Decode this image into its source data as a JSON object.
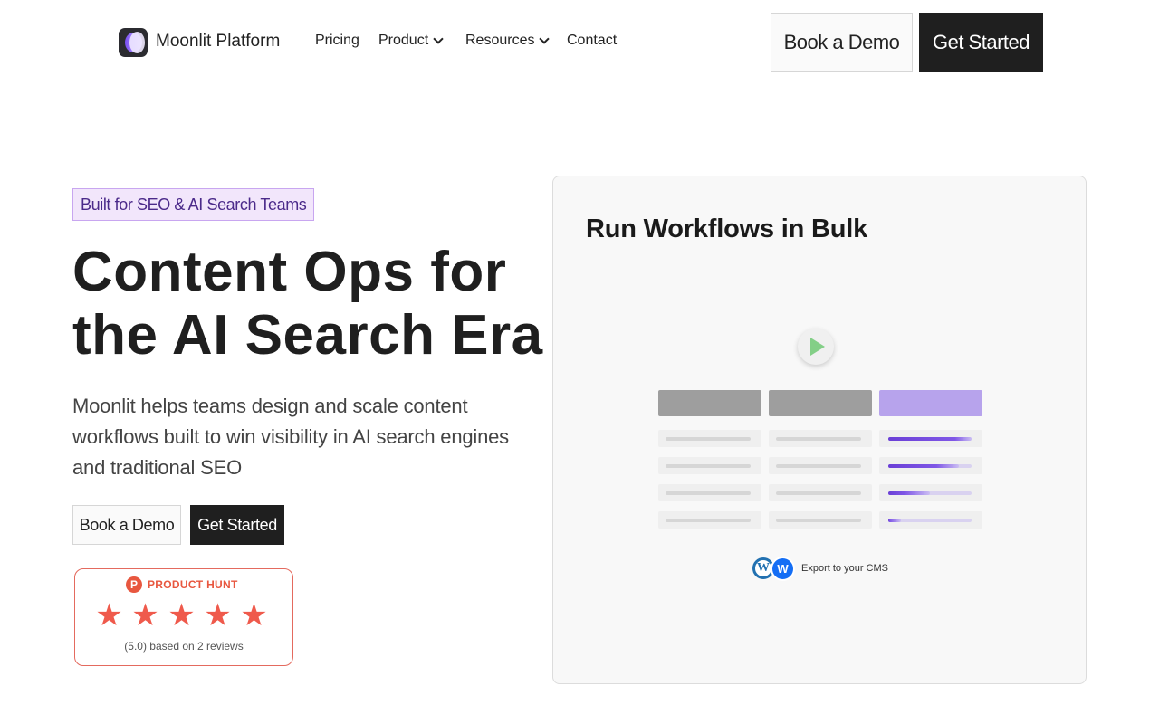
{
  "header": {
    "brand": "Moonlit Platform",
    "nav": [
      {
        "label": "Pricing",
        "dropdown": false
      },
      {
        "label": "Product",
        "dropdown": true
      },
      {
        "label": "Resources",
        "dropdown": true
      },
      {
        "label": "Contact",
        "dropdown": false
      }
    ],
    "book_demo_label": "Book a Demo",
    "get_started_label": "Get Started"
  },
  "hero": {
    "badge": "Built for SEO & AI Search Teams",
    "headline_line1": "Content Ops for",
    "headline_line2": "the AI Search Era",
    "subtext": "Moonlit helps teams design and scale content workflows built to win visibility in AI search engines and traditional SEO",
    "book_demo_label": "Book a Demo",
    "get_started_label": "Get Started"
  },
  "product_hunt": {
    "logo_letter": "P",
    "label": "PRODUCT HUNT",
    "rating": 5,
    "reviews_text": "(5.0) based on 2 reviews"
  },
  "panel": {
    "title": "Run Workflows in Bulk",
    "export_text": "Export to your CMS",
    "cms_icons": [
      "wordpress-icon",
      "webflow-icon"
    ],
    "progress_rows": [
      1.0,
      0.85,
      0.5,
      0.15
    ]
  },
  "colors": {
    "accent_purple": "#7a4ff2",
    "dark_button": "#1f1f1f",
    "product_hunt": "#e8573f",
    "play_green": "#83cf87"
  }
}
